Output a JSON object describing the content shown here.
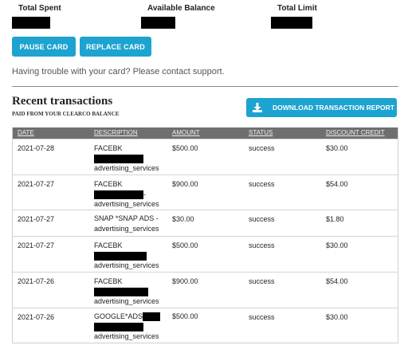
{
  "summary": {
    "total_spent_label": "Total Spent",
    "available_balance_label": "Available Balance",
    "total_limit_label": "Total Limit"
  },
  "buttons": {
    "pause_card": "PAUSE CARD",
    "replace_card": "REPLACE CARD",
    "download_report": "DOWNLOAD TRANSACTION REPORT"
  },
  "help_text": "Having trouble with your card? Please contact support.",
  "recent": {
    "title": "Recent transactions",
    "subtitle": "PAID FROM YOUR CLEARCO BALANCE"
  },
  "table": {
    "headers": {
      "date": "DATE",
      "description": "DESCRIPTION",
      "amount": "AMOUNT",
      "status": "STATUS",
      "discount": "DISCOUNT CREDIT"
    },
    "rows": [
      {
        "date": "2021-07-28",
        "desc1": "FACEBK",
        "desc3": "advertising_services",
        "amount": "$500.00",
        "status": "success",
        "discount": "$30.00"
      },
      {
        "date": "2021-07-27",
        "desc1": "FACEBK",
        "desc2_suffix": "-",
        "desc3": "advertising_services",
        "amount": "$900.00",
        "status": "success",
        "discount": "$54.00"
      },
      {
        "date": "2021-07-27",
        "desc1": "SNAP *SNAP ADS -",
        "desc3": "advertising_services",
        "amount": "$30.00",
        "status": "success",
        "discount": "$1.80"
      },
      {
        "date": "2021-07-27",
        "desc1": "FACEBK",
        "desc3": "advertising_services",
        "amount": "$500.00",
        "status": "success",
        "discount": "$30.00"
      },
      {
        "date": "2021-07-26",
        "desc1": "FACEBK",
        "desc3": "advertising_services",
        "amount": "$900.00",
        "status": "success",
        "discount": "$54.00"
      },
      {
        "date": "2021-07-26",
        "desc1": "GOOGLE*ADS",
        "desc3": "advertising_services",
        "amount": "$500.00",
        "status": "success",
        "discount": "$30.00"
      }
    ]
  },
  "colors": {
    "accent": "#1da3d0",
    "table_header": "#6f6f6f"
  },
  "icons": {
    "download": "download-icon"
  }
}
